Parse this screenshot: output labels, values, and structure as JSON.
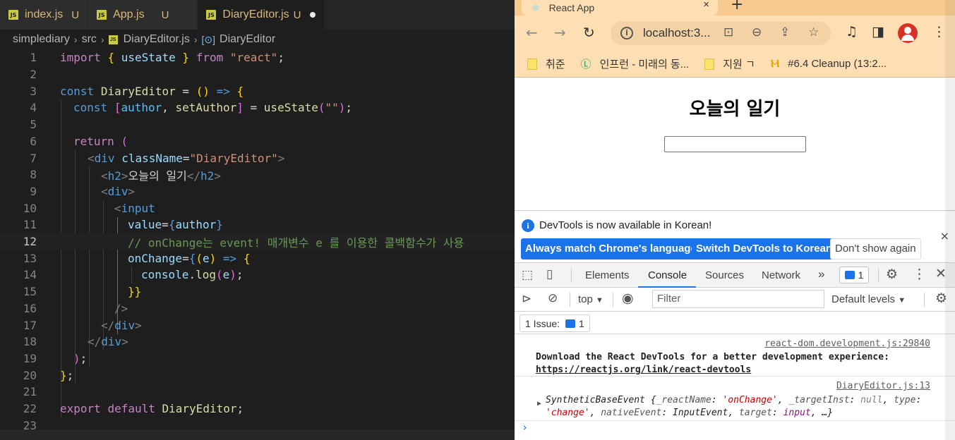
{
  "editor": {
    "tabs": [
      {
        "label": "index.js",
        "status": "U"
      },
      {
        "label": "App.js",
        "status": "U"
      },
      {
        "label": "DiaryEditor.js",
        "status": "U"
      }
    ],
    "breadcrumb": [
      "simplediary",
      "src",
      "DiaryEditor.js",
      "DiaryEditor"
    ],
    "line_numbers": [
      "1",
      "2",
      "3",
      "4",
      "5",
      "6",
      "7",
      "8",
      "9",
      "10",
      "11",
      "12",
      "13",
      "14",
      "15",
      "16",
      "17",
      "18",
      "19",
      "20",
      "21",
      "22",
      "23"
    ],
    "current_line": 12,
    "code": {
      "l1_kw": "import",
      "l1_b1": "{",
      "l1_fn": "useState",
      "l1_b2": "}",
      "l1_from": "from",
      "l1_str": "\"react\"",
      "l1_end": ";",
      "l3_kw": "const",
      "l3_name": "DiaryEditor",
      "l3_eq": "=",
      "l3_paren": "()",
      "l3_arrow": "=>",
      "l3_b": "{",
      "l4_kw": "const",
      "l4_b1": "[",
      "l4_v1": "author",
      "l4_comma": ",",
      "l4_v2": "setAuthor",
      "l4_b2": "]",
      "l4_eq": "=",
      "l4_fn": "useState",
      "l4_p1": "(",
      "l4_str": "\"\"",
      "l4_p2": ")",
      "l4_end": ";",
      "l6_kw": "return",
      "l6_p": "(",
      "l7_lt": "<",
      "l7_tag": "div",
      "l7_attr": "className",
      "l7_eq": "=",
      "l7_str": "\"DiaryEditor\"",
      "l7_gt": ">",
      "l8_lt": "<",
      "l8_tag": "h2",
      "l8_gt": ">",
      "l8_text": "오늘의 일기",
      "l8_close_lt": "</",
      "l8_close_tag": "h2",
      "l8_close_gt": ">",
      "l9_lt": "<",
      "l9_tag": "div",
      "l9_gt": ">",
      "l10_lt": "<",
      "l10_tag": "input",
      "l11_attr": "value",
      "l11_eq": "=",
      "l11_b1": "{",
      "l11_var": "author",
      "l11_b2": "}",
      "l12_cmt": "// onChange는 event! 매개변수 e 를 이용한 콜백함수가 사용",
      "l13_attr": "onChange",
      "l13_eq": "=",
      "l13_b1": "{",
      "l13_p1": "(",
      "l13_var": "e",
      "l13_p2": ")",
      "l13_arrow": "=>",
      "l13_b2": "{",
      "l14_obj": "console",
      "l14_dot": ".",
      "l14_fn": "log",
      "l14_p1": "(",
      "l14_var": "e",
      "l14_p2": ")",
      "l14_end": ";",
      "l15_b": "}}",
      "l16_close": "/>",
      "l17_lt": "</",
      "l17_tag": "div",
      "l17_gt": ">",
      "l18_lt": "</",
      "l18_tag": "div",
      "l18_gt": ">",
      "l19_p": ")",
      "l19_end": ";",
      "l20_b": "}",
      "l20_end": ";",
      "l22_kw1": "export",
      "l22_kw2": "default",
      "l22_name": "DiaryEditor",
      "l22_end": ";"
    }
  },
  "browser": {
    "tab_title": "React App",
    "tab_close": "×",
    "new_tab": "+",
    "url": "localhost:3...",
    "bookmarks": [
      "취준",
      "인프런 - 미래의 동...",
      "지원 ㄱ",
      "#6.4 Cleanup (13:2..."
    ],
    "page": {
      "heading": "오늘의 일기",
      "input_value": ""
    },
    "devtools": {
      "infobar_message": "DevTools is now available in Korean!",
      "btn_match": "Always match Chrome's language",
      "btn_switch": "Switch DevTools to Korean",
      "btn_dont_show": "Don't show again",
      "close": "×",
      "tabs": [
        "Elements",
        "Console",
        "Sources",
        "Network"
      ],
      "more_tabs": "»",
      "issues_badge": "1",
      "context": "top",
      "filter_placeholder": "Filter",
      "levels": "Default levels",
      "issue_label": "1 Issue:",
      "issue_count": "1",
      "logs": [
        {
          "source": "react-dom.development.js:29840",
          "text_a": "Download the React DevTools for a better development experience: ",
          "link": "https://reactjs.org/link/react-devtools"
        },
        {
          "source": "DiaryEditor.js:13"
        }
      ],
      "event_log": {
        "name": "SyntheticBaseEvent",
        "open": "{",
        "k1": "_reactName",
        "v1": "'onChange'",
        "k2": "_targetInst",
        "v2": "null",
        "k3": "type",
        "v3": "'change'",
        "k4": "nativeEvent",
        "v4": "InputEvent",
        "k5": "target",
        "v5": "input",
        "tail": "…}"
      },
      "prompt": "›"
    }
  },
  "colors": {
    "editor_bg": "#1e1e1e",
    "chrome_theme": "#fddfb3",
    "devtools_accent": "#1a73e8"
  }
}
